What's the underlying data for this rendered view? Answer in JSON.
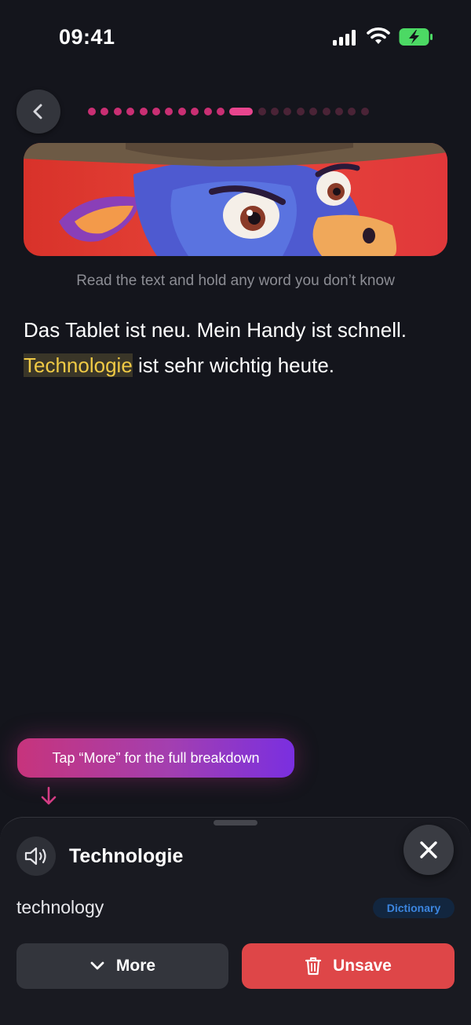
{
  "status_bar": {
    "time": "09:41",
    "icons": [
      "signal-icon",
      "wifi-icon",
      "battery-charging-icon"
    ],
    "battery_color": "#4cd964"
  },
  "header": {
    "back_icon": "chevron-left-icon",
    "progress": {
      "total_steps": 21,
      "current_step": 12
    }
  },
  "banner": {
    "image": "cartoon-donkey-cowboy-hat"
  },
  "lesson": {
    "instruction": "Read the text and hold any word you don’t know",
    "sentence_1": "Das Tablet ist neu. Mein Handy ist schnell.",
    "highlighted_word": "Technologie",
    "sentence_2_rest": " ist sehr wichtig heute."
  },
  "hint": {
    "text": "Tap “More” for the full breakdown"
  },
  "word_sheet": {
    "word": "Technologie",
    "translation": "technology",
    "source_badge": "Dictionary",
    "more_label": "More",
    "unsave_label": "Unsave"
  },
  "colors": {
    "background": "#14151c",
    "accent_pink": "#e8458e",
    "highlight_text": "#f0ca45",
    "unsave_red": "#de4648",
    "dictionary_blue": "#3c86e0"
  }
}
